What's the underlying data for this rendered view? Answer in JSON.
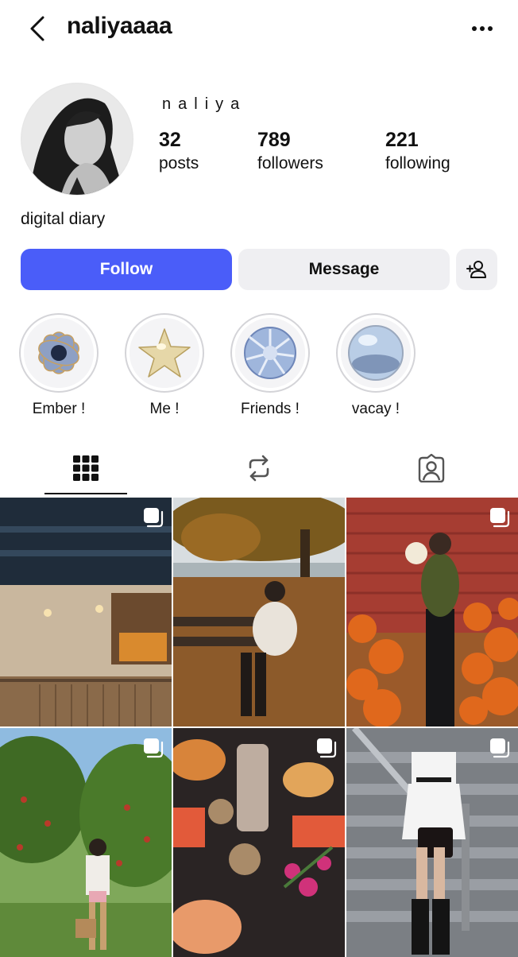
{
  "header": {
    "username": "naliyaaaa"
  },
  "profile": {
    "display_name": "naliya",
    "bio": "digital diary",
    "stats": [
      {
        "value": "32",
        "label": "posts"
      },
      {
        "value": "789",
        "label": "followers"
      },
      {
        "value": "221",
        "label": "following"
      }
    ]
  },
  "actions": {
    "follow_label": "Follow",
    "message_label": "Message"
  },
  "highlights": [
    {
      "label": "Ember !"
    },
    {
      "label": "Me !"
    },
    {
      "label": "Friends !"
    },
    {
      "label": "vacay !"
    }
  ],
  "tabs": [
    {
      "icon": "grid-icon",
      "active": true
    },
    {
      "icon": "reels-icon",
      "active": false
    },
    {
      "icon": "tagged-icon",
      "active": false
    }
  ],
  "colors": {
    "accent": "#4a5df9",
    "secondary_button": "#efeff2"
  }
}
